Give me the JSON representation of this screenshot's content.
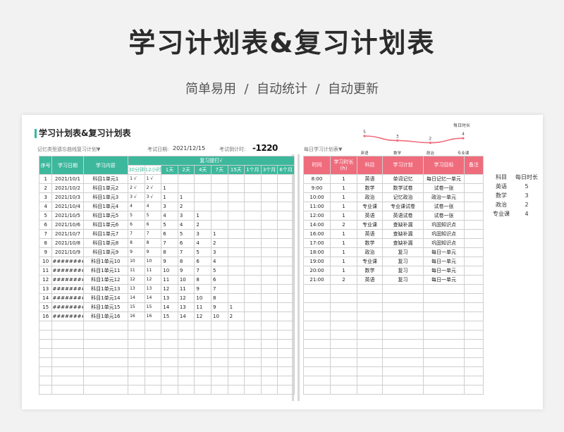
{
  "hero": {
    "title": "学习计划表&复习计划表",
    "subtitle": "简单易用  /  自动统计  /  自动更新"
  },
  "colors": {
    "teal": "#3db89c",
    "pink": "#ef6c7d"
  },
  "sheet": {
    "title": "学习计划表&复习计划表",
    "memory_label": "记忆类型遗忘曲线复习计划▼",
    "exam_date_label": "考试日期:",
    "exam_date": "2021/12/15",
    "countdown_label": "考试倒计时:",
    "countdown": "-1220",
    "daily_label": "每日学习计划表▼"
  },
  "left_table": {
    "headers": [
      "序号",
      "学习日期",
      "学习内容"
    ],
    "review_header": "复习提打√",
    "sub_headers": [
      "30分钟",
      "12小时",
      "1天",
      "2天",
      "4天",
      "7天",
      "15天",
      "1个月",
      "3个月",
      "6个月"
    ],
    "rows": [
      {
        "no": "1",
        "date": "2021/10/1",
        "content": "科目1单元1",
        "r": [
          "1 √",
          "1 √",
          "",
          "",
          "",
          "",
          "",
          "",
          "",
          ""
        ]
      },
      {
        "no": "2",
        "date": "2021/10/2",
        "content": "科目1单元2",
        "r": [
          "2 √",
          "2 √",
          "1",
          "",
          "",
          "",
          "",
          "",
          "",
          ""
        ]
      },
      {
        "no": "3",
        "date": "2021/10/3",
        "content": "科目1单元3",
        "r": [
          "3 √",
          "3 √",
          "1",
          "1",
          "",
          "",
          "",
          "",
          "",
          ""
        ]
      },
      {
        "no": "4",
        "date": "2021/10/4",
        "content": "科目1单元4",
        "r": [
          "4",
          "4",
          "3",
          "2",
          "",
          "",
          "",
          "",
          "",
          ""
        ]
      },
      {
        "no": "5",
        "date": "2021/10/5",
        "content": "科目1单元5",
        "r": [
          "5",
          "5",
          "4",
          "3",
          "1",
          "",
          "",
          "",
          "",
          ""
        ]
      },
      {
        "no": "6",
        "date": "2021/10/6",
        "content": "科目1单元6",
        "r": [
          "6",
          "6",
          "5",
          "4",
          "2",
          "",
          "",
          "",
          "",
          ""
        ]
      },
      {
        "no": "7",
        "date": "2021/10/7",
        "content": "科目1单元7",
        "r": [
          "7",
          "7",
          "6",
          "5",
          "3",
          "1",
          "",
          "",
          "",
          ""
        ]
      },
      {
        "no": "8",
        "date": "2021/10/8",
        "content": "科目1单元8",
        "r": [
          "8",
          "8",
          "7",
          "6",
          "4",
          "2",
          "",
          "",
          "",
          ""
        ]
      },
      {
        "no": "9",
        "date": "2021/10/9",
        "content": "科目1单元9",
        "r": [
          "9",
          "9",
          "8",
          "7",
          "5",
          "3",
          "",
          "",
          "",
          ""
        ]
      },
      {
        "no": "10",
        "date": "########",
        "content": "科目1单元10",
        "r": [
          "10",
          "10",
          "9",
          "8",
          "6",
          "4",
          "",
          "",
          "",
          ""
        ]
      },
      {
        "no": "11",
        "date": "########",
        "content": "科目1单元11",
        "r": [
          "11",
          "11",
          "10",
          "9",
          "7",
          "5",
          "",
          "",
          "",
          ""
        ]
      },
      {
        "no": "12",
        "date": "########",
        "content": "科目1单元12",
        "r": [
          "12",
          "12",
          "11",
          "10",
          "8",
          "6",
          "",
          "",
          "",
          ""
        ]
      },
      {
        "no": "13",
        "date": "########",
        "content": "科目1单元13",
        "r": [
          "13",
          "13",
          "12",
          "11",
          "9",
          "7",
          "",
          "",
          "",
          ""
        ]
      },
      {
        "no": "14",
        "date": "########",
        "content": "科目1单元14",
        "r": [
          "14",
          "14",
          "13",
          "12",
          "10",
          "8",
          "",
          "",
          "",
          ""
        ]
      },
      {
        "no": "15",
        "date": "########",
        "content": "科目1单元15",
        "r": [
          "15",
          "15",
          "14",
          "13",
          "11",
          "9",
          "1",
          "",
          "",
          ""
        ]
      },
      {
        "no": "16",
        "date": "########",
        "content": "科目1单元16",
        "r": [
          "16",
          "16",
          "15",
          "14",
          "12",
          "10",
          "2",
          "",
          "",
          ""
        ]
      }
    ]
  },
  "right_table": {
    "headers": [
      "时间",
      "学习时长(h)",
      "科目",
      "学习计划",
      "学习目标",
      "备注"
    ],
    "rows": [
      {
        "time": "8:00",
        "hours": "1",
        "subject": "英语",
        "plan": "单词记忆",
        "goal": "每日记忆一单元",
        "note": ""
      },
      {
        "time": "9:00",
        "hours": "1",
        "subject": "数学",
        "plan": "数学试卷",
        "goal": "试卷一张",
        "note": ""
      },
      {
        "time": "10:00",
        "hours": "1",
        "subject": "政治",
        "plan": "记忆政治",
        "goal": "政治一单元",
        "note": ""
      },
      {
        "time": "11:00",
        "hours": "1",
        "subject": "专业课",
        "plan": "专业课试卷",
        "goal": "试卷一张",
        "note": ""
      },
      {
        "time": "12:00",
        "hours": "1",
        "subject": "英语",
        "plan": "英语试卷",
        "goal": "试卷一张",
        "note": ""
      },
      {
        "time": "14:00",
        "hours": "2",
        "subject": "专业课",
        "plan": "查缺补漏",
        "goal": "巩固知识点",
        "note": ""
      },
      {
        "time": "16:00",
        "hours": "1",
        "subject": "英语",
        "plan": "查缺补漏",
        "goal": "巩固知识点",
        "note": ""
      },
      {
        "time": "17:00",
        "hours": "1",
        "subject": "数学",
        "plan": "查缺补漏",
        "goal": "巩固知识点",
        "note": ""
      },
      {
        "time": "18:00",
        "hours": "1",
        "subject": "政治",
        "plan": "复习",
        "goal": "每日一单元",
        "note": ""
      },
      {
        "time": "19:00",
        "hours": "1",
        "subject": "专业课",
        "plan": "复习",
        "goal": "每日一单元",
        "note": ""
      },
      {
        "time": "20:00",
        "hours": "1",
        "subject": "数学",
        "plan": "复习",
        "goal": "每日一单元",
        "note": ""
      },
      {
        "time": "21:00",
        "hours": "2",
        "subject": "英语",
        "plan": "复习",
        "goal": "每日一单元",
        "note": ""
      }
    ]
  },
  "stats": {
    "header_subject": "科目",
    "header_hours": "每日时长",
    "rows": [
      {
        "subject": "英语",
        "hours": "5"
      },
      {
        "subject": "数学",
        "hours": "3"
      },
      {
        "subject": "政治",
        "hours": "2"
      },
      {
        "subject": "专业课",
        "hours": "4"
      }
    ]
  },
  "chart_data": {
    "type": "line",
    "title": "每日时长",
    "categories": [
      "英语",
      "数学",
      "政治",
      "专业课"
    ],
    "values": [
      5,
      3,
      2,
      4
    ],
    "color": "#ef6c7d"
  }
}
